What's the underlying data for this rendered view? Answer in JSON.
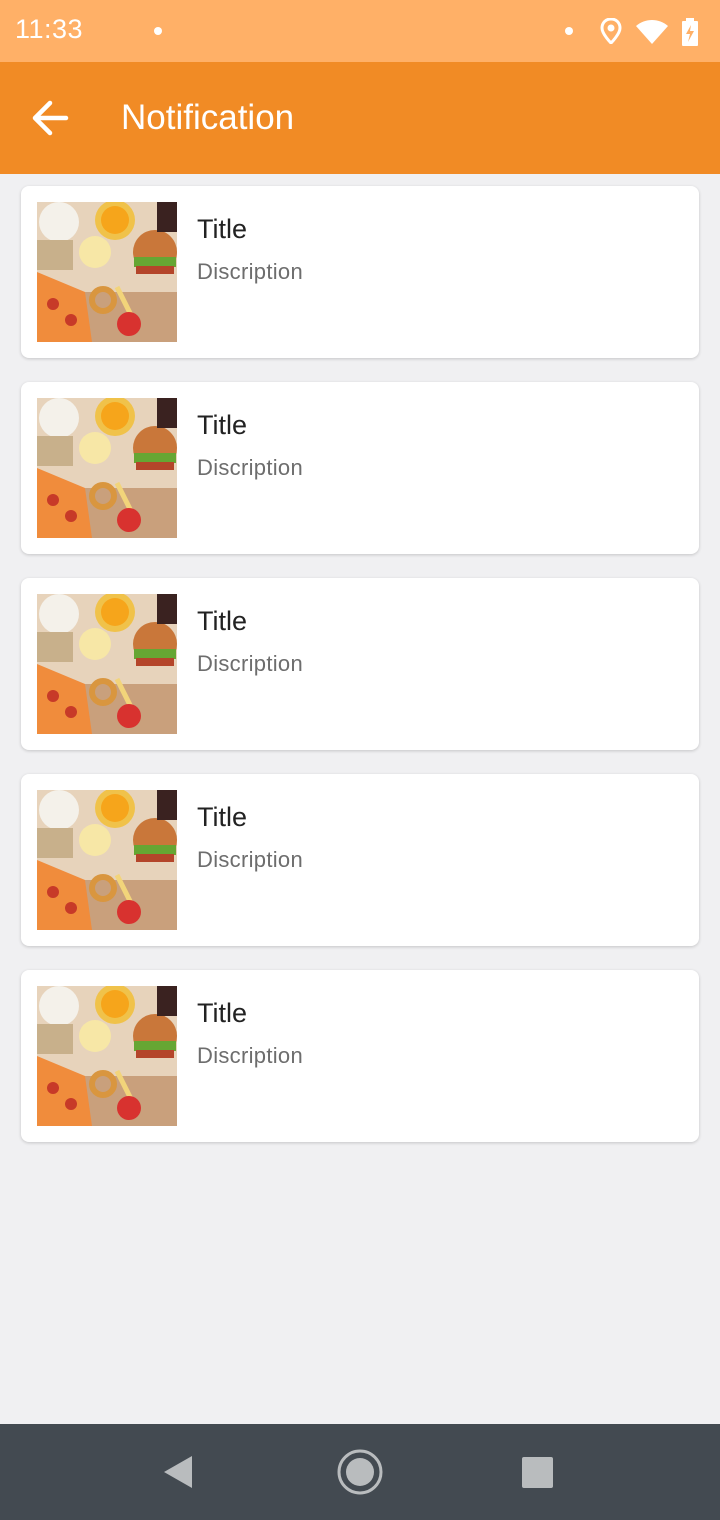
{
  "status_bar": {
    "time": "11:33"
  },
  "app_bar": {
    "title": "Notification",
    "back_icon": "arrow-back-icon"
  },
  "notifications": [
    {
      "title": "Title",
      "description": "Discription"
    },
    {
      "title": "Title",
      "description": "Discription"
    },
    {
      "title": "Title",
      "description": "Discription"
    },
    {
      "title": "Title",
      "description": "Discription"
    },
    {
      "title": "Title",
      "description": "Discription"
    }
  ],
  "colors": {
    "status_bar": "#ffb067",
    "app_bar": "#f18b25",
    "background": "#f0f0f2",
    "nav_bar": "#434a51"
  },
  "nav_bar": {
    "icons": [
      "nav-back-icon",
      "nav-home-icon",
      "nav-recents-icon"
    ]
  }
}
